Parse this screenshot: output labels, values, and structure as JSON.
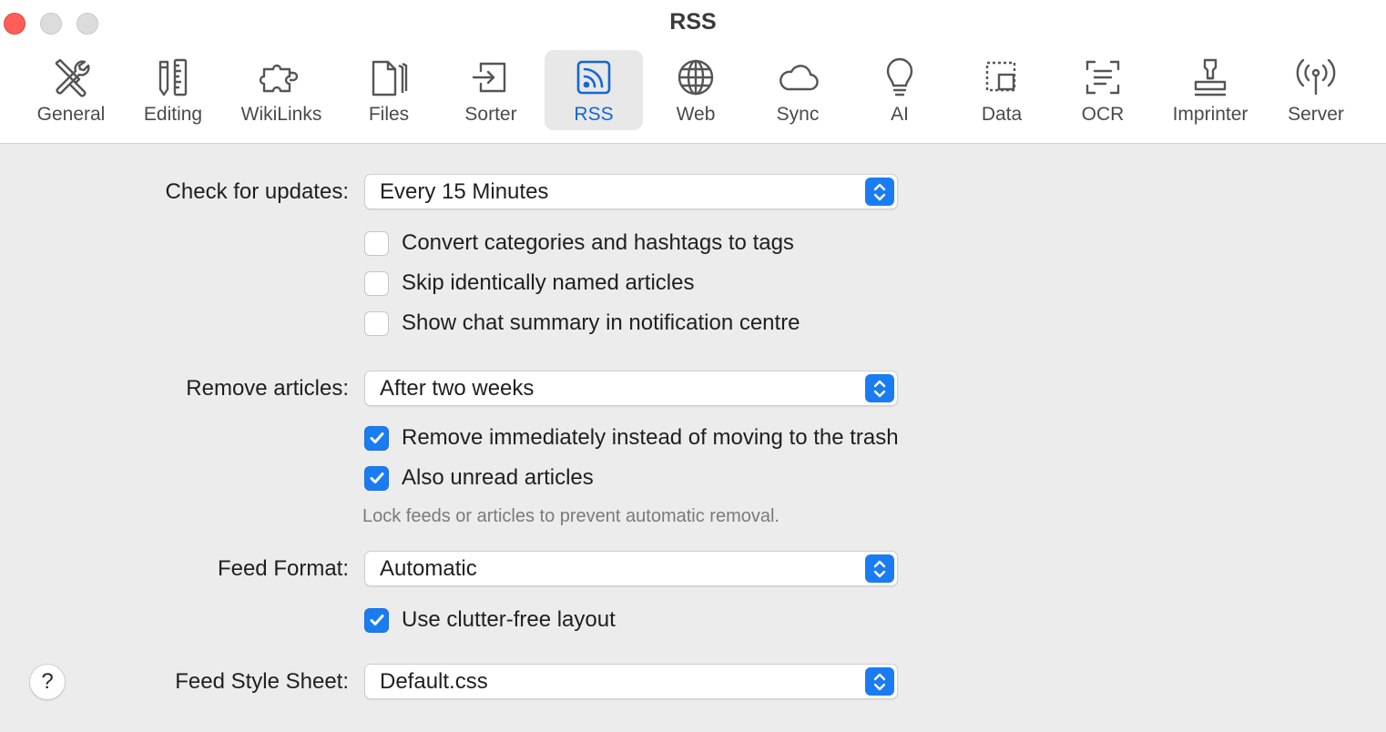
{
  "window": {
    "title": "RSS"
  },
  "tabs": [
    {
      "label": "General",
      "icon": "wrench-screwdriver-icon"
    },
    {
      "label": "Editing",
      "icon": "pencil-ruler-icon"
    },
    {
      "label": "WikiLinks",
      "icon": "puzzle-icon"
    },
    {
      "label": "Files",
      "icon": "documents-icon"
    },
    {
      "label": "Sorter",
      "icon": "sorter-tray-icon"
    },
    {
      "label": "RSS",
      "icon": "rss-icon",
      "active": true
    },
    {
      "label": "Web",
      "icon": "globe-icon"
    },
    {
      "label": "Sync",
      "icon": "cloud-icon"
    },
    {
      "label": "AI",
      "icon": "lightbulb-icon"
    },
    {
      "label": "Data",
      "icon": "data-selection-icon"
    },
    {
      "label": "OCR",
      "icon": "text-scan-icon"
    },
    {
      "label": "Imprinter",
      "icon": "stamp-icon"
    },
    {
      "label": "Server",
      "icon": "antenna-icon"
    }
  ],
  "form": {
    "check_updates": {
      "label": "Check for updates:",
      "value": "Every 15 Minutes"
    },
    "update_options": [
      {
        "label": "Convert categories and hashtags to tags",
        "checked": false
      },
      {
        "label": "Skip identically named articles",
        "checked": false
      },
      {
        "label": "Show chat summary in notification centre",
        "checked": false
      }
    ],
    "remove_articles": {
      "label": "Remove articles:",
      "value": "After two weeks"
    },
    "remove_options": [
      {
        "label": "Remove immediately instead of moving to the trash",
        "checked": true
      },
      {
        "label": "Also unread articles",
        "checked": true
      }
    ],
    "remove_hint": "Lock feeds or articles to prevent automatic removal.",
    "feed_format": {
      "label": "Feed Format:",
      "value": "Automatic"
    },
    "format_options": [
      {
        "label": "Use clutter-free layout",
        "checked": true
      }
    ],
    "feed_style_sheet": {
      "label": "Feed Style Sheet:",
      "value": "Default.css"
    }
  },
  "help": {
    "label": "?"
  },
  "colors": {
    "accent": "#1a7cf2",
    "active_tab_text": "#1466d6",
    "close_button": "#ff5f57",
    "window_background": "#ececec"
  }
}
